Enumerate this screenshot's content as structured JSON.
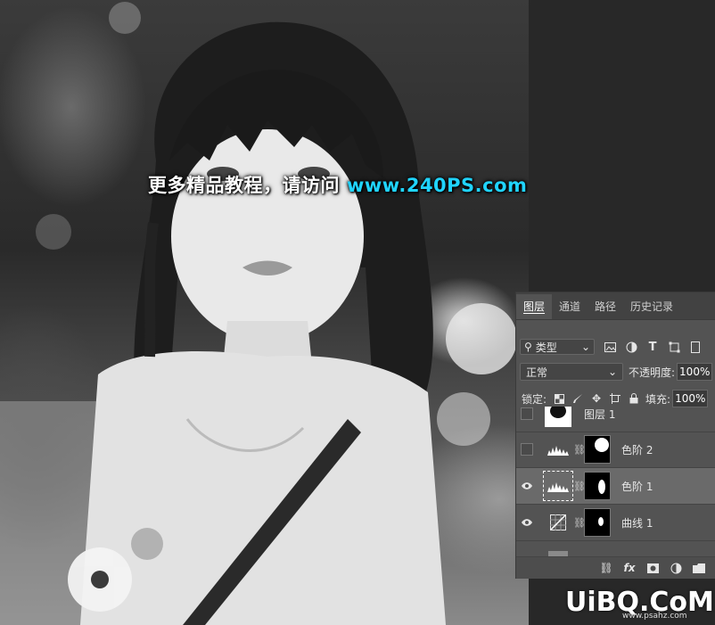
{
  "watermark": {
    "text": "更多精品教程，请访问",
    "url": "www.240PS.com"
  },
  "layers_panel": {
    "tabs": [
      {
        "label": "图层",
        "active": true
      },
      {
        "label": "通道",
        "active": false
      },
      {
        "label": "路径",
        "active": false
      },
      {
        "label": "历史记录",
        "active": false
      }
    ],
    "filter": {
      "label": "类型",
      "icons": [
        "image-filter-icon",
        "adjustment-filter-icon",
        "type-filter-icon",
        "shape-filter-icon",
        "smart-object-filter-icon"
      ]
    },
    "blend_mode": "正常",
    "opacity_label": "不透明度:",
    "opacity_value": "100%",
    "lock_label": "锁定:",
    "lock_icons": [
      "lock-transparent-icon",
      "lock-brush-icon",
      "lock-move-icon",
      "lock-artboard-icon",
      "lock-all-icon"
    ],
    "fill_label": "填充:",
    "fill_value": "100%",
    "layers": [
      {
        "name": "图层 1",
        "visible": false,
        "type": "pixel",
        "selected": false
      },
      {
        "name": "色阶 2",
        "visible": false,
        "type": "levels",
        "selected": false
      },
      {
        "name": "色阶 1",
        "visible": true,
        "type": "levels",
        "selected": true
      },
      {
        "name": "曲线 1",
        "visible": true,
        "type": "curves",
        "selected": false
      }
    ],
    "bottom_icons": [
      "link-layers-icon",
      "fx-icon",
      "add-mask-icon",
      "adjustment-layer-icon",
      "new-group-icon"
    ]
  },
  "site_logo": {
    "text": "UiBQ.CoM",
    "subtext": "www.psahz.com"
  },
  "colors": {
    "url_color": "#20d4ff",
    "panel_bg": "#535353",
    "selected_row": "#6a6a6a"
  }
}
